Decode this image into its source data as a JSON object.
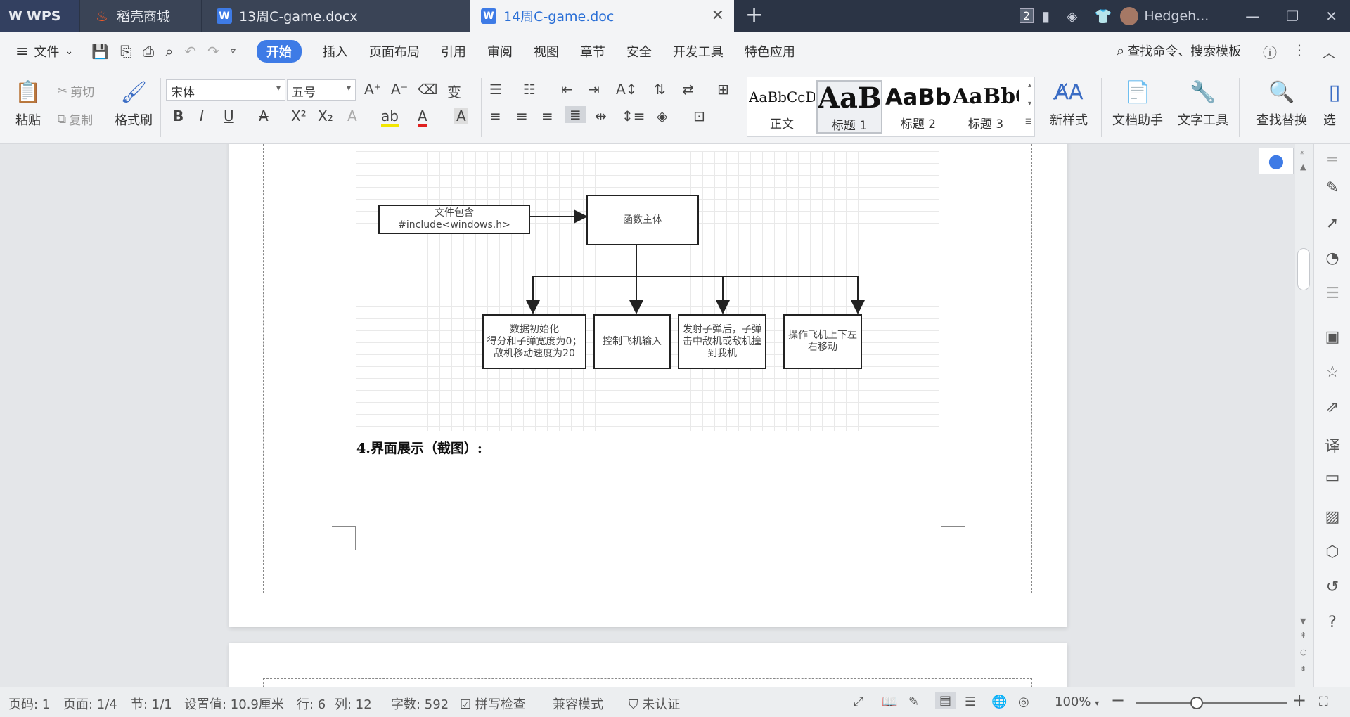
{
  "tabs": {
    "wps": "WPS",
    "store": "稻壳商城",
    "doc13": "13周C-game.docx",
    "doc14": "14周C-game.doc",
    "add": "+"
  },
  "titlebar": {
    "window_count": "2",
    "user_name": "Hedgeh..."
  },
  "menu": {
    "file": "文件",
    "items": [
      "开始",
      "插入",
      "页面布局",
      "引用",
      "审阅",
      "视图",
      "章节",
      "安全",
      "开发工具",
      "特色应用"
    ],
    "search": "查找命令、搜索模板"
  },
  "ribbon": {
    "paste": "粘贴",
    "cut": "剪切",
    "copy": "复制",
    "format_painter": "格式刷",
    "font_name": "宋体",
    "font_size": "五号",
    "styles": [
      {
        "sample": "AaBbCcDd",
        "name": "正文"
      },
      {
        "sample": "AaBl",
        "name": "标题 1"
      },
      {
        "sample": "AaBb(",
        "name": "标题 2"
      },
      {
        "sample": "AaBbC",
        "name": "标题 3"
      }
    ],
    "new_style": "新样式",
    "doc_assistant": "文档助手",
    "text_tools": "文字工具",
    "find_replace": "查找替换",
    "select": "选"
  },
  "document": {
    "flowchart": {
      "include_box": "文件包含\n#include<windows.h>",
      "main_box": "函数主体",
      "children": [
        "数据初始化\n得分和子弹宽度为0；敌机移动速度为20",
        "控制飞机输入",
        "发射子弹后，子弹击中敌机或敌机撞到我机",
        "操作飞机上下左右移动"
      ]
    },
    "heading4": "4.界面展示（截图）:"
  },
  "status": {
    "page": "页码: 1",
    "pages": "页面: 1/4",
    "section": "节: 1/1",
    "setting": "设置值: 10.9厘米",
    "row": "行: 6",
    "col": "列: 12",
    "words": "字数: 592",
    "spellcheck": "拼写检查",
    "compat": "兼容模式",
    "cert": "未认证",
    "zoom": "100%",
    "zoom_level_fraction": 0.4
  }
}
